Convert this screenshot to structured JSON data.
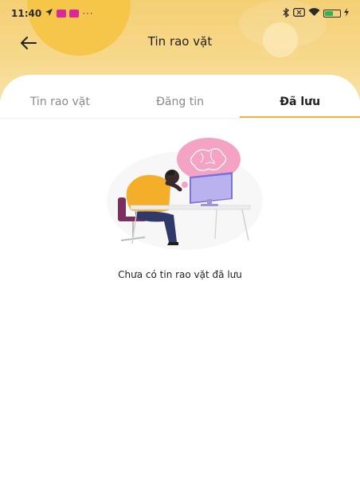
{
  "status_bar": {
    "time": "11:40",
    "dots": "···",
    "battery_level": 0.61,
    "icons": [
      "location-arrow-icon",
      "app-badge-icon",
      "app-badge-icon",
      "bluetooth-icon",
      "sim-icon",
      "wifi-icon",
      "battery-icon",
      "charging-icon"
    ]
  },
  "app_bar": {
    "title": "Tin rao vặt",
    "back_icon": "arrow-left-icon"
  },
  "tabs": [
    {
      "label": "Tin rao vặt",
      "active": false
    },
    {
      "label": "Đăng tin",
      "active": false
    },
    {
      "label": "Đã lưu",
      "active": true
    }
  ],
  "empty_state": {
    "illustration": "person-at-desk-thinking",
    "message": "Chưa có tin rao vặt đã lưu"
  },
  "colors": {
    "header": "#f4cf74",
    "accent": "#f0b43c",
    "thought_bubble": "#f4a3c4"
  }
}
